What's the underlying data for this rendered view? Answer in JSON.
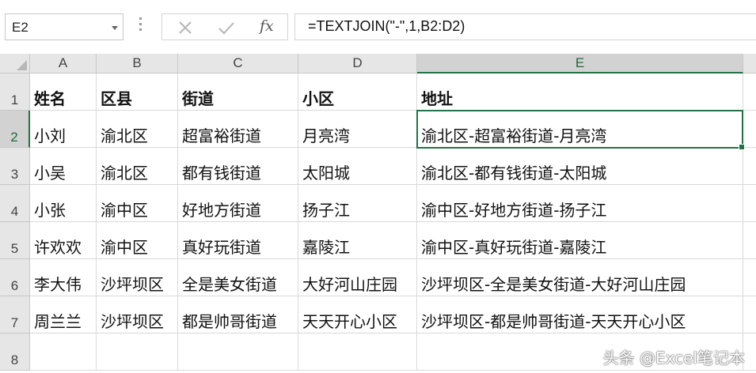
{
  "name_box": "E2",
  "formula_bar": {
    "cancel_icon": "x-icon",
    "enter_icon": "check-icon",
    "function_icon": "fx-icon",
    "function_label": "fx",
    "formula": "=TEXTJOIN(\"-\",1,B2:D2)"
  },
  "columns": [
    "A",
    "B",
    "C",
    "D",
    "E"
  ],
  "selected_column": "E",
  "selected_row": "2",
  "rows": [
    {
      "num": "1",
      "cells": [
        "姓名",
        "区县",
        "街道",
        "小区",
        "地址"
      ]
    },
    {
      "num": "2",
      "cells": [
        "小刘",
        "渝北区",
        "超富裕街道",
        "月亮湾",
        "渝北区-超富裕街道-月亮湾"
      ]
    },
    {
      "num": "3",
      "cells": [
        "小吴",
        "渝北区",
        "都有钱街道",
        "太阳城",
        "渝北区-都有钱街道-太阳城"
      ]
    },
    {
      "num": "4",
      "cells": [
        "小张",
        "渝中区",
        "好地方街道",
        "扬子江",
        "渝中区-好地方街道-扬子江"
      ]
    },
    {
      "num": "5",
      "cells": [
        "许欢欢",
        "渝中区",
        "真好玩街道",
        "嘉陵江",
        "渝中区-真好玩街道-嘉陵江"
      ]
    },
    {
      "num": "6",
      "cells": [
        "李大伟",
        "沙坪坝区",
        "全是美女街道",
        "大好河山庄园",
        "沙坪坝区-全是美女街道-大好河山庄园"
      ]
    },
    {
      "num": "7",
      "cells": [
        "周兰兰",
        "沙坪坝区",
        "都是帅哥街道",
        "天天开心小区",
        "沙坪坝区-都是帅哥街道-天天开心小区"
      ]
    },
    {
      "num": "8",
      "cells": [
        "",
        "",
        "",
        "",
        ""
      ]
    }
  ],
  "watermark": "头条 @Excel笔记本",
  "colors": {
    "accent": "#217346",
    "header_bg": "#e6e6e6",
    "selected_header_bg": "#d2d2d2"
  }
}
